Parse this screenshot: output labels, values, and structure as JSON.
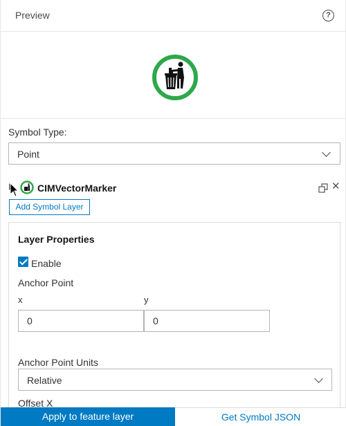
{
  "preview": {
    "title": "Preview",
    "help_icon": "help-circle-icon",
    "symbol_icon": "no-littering-icon",
    "symbol_ring_color": "#2ea84a"
  },
  "symbol_type": {
    "label": "Symbol Type:",
    "value": "Point"
  },
  "layer": {
    "name": "CIMVectorMarker",
    "add_button_label": "Add Symbol Layer"
  },
  "layer_properties": {
    "title": "Layer Properties",
    "enable_label": "Enable",
    "enable_checked": true,
    "anchor_point_label": "Anchor Point",
    "x_label": "x",
    "y_label": "y",
    "x_value": "0",
    "y_value": "0",
    "anchor_units_label": "Anchor Point Units",
    "anchor_units_value": "Relative",
    "offset_x_label": "Offset X"
  },
  "footer": {
    "apply_label": "Apply to feature layer",
    "json_label": "Get Symbol JSON"
  },
  "colors": {
    "accent": "#007ac2",
    "symbol_green": "#2ea84a"
  }
}
